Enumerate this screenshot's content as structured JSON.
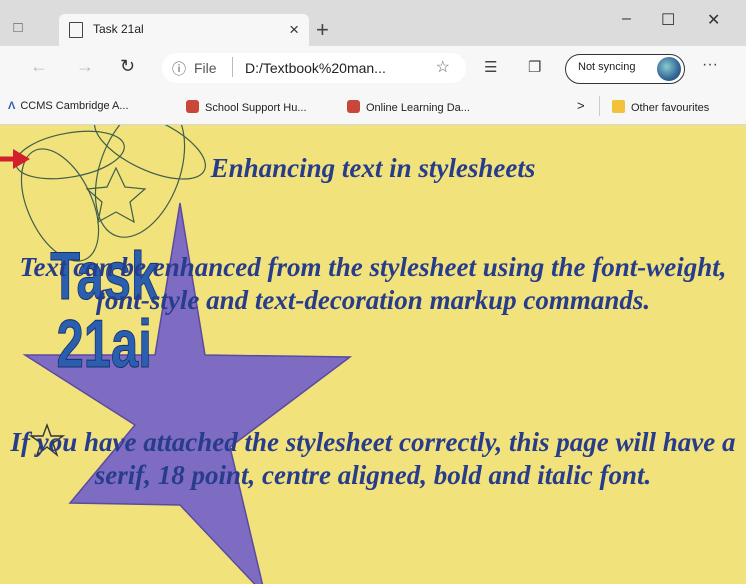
{
  "browser": {
    "tab_title": "Task 21al",
    "address_info": "ⓘ",
    "address_scheme": "File",
    "address_url": "D:/Textbook%20man...",
    "sync_label": "Not syncing",
    "more_label": "···"
  },
  "bookmarks": {
    "items": [
      {
        "label": "CCMS Cambridge A...",
        "color": "#2a5fb0"
      },
      {
        "label": "School Support Hu...",
        "color": "#c8463a"
      },
      {
        "label": "Online Learning Da...",
        "color": "#c8463a"
      }
    ],
    "chevron": ">",
    "other": "Other favourites"
  },
  "page": {
    "heading": "Enhancing text in stylesheets",
    "paragraph1": "Text can be enhanced from the stylesheet using the font-weight, font-style and text-decoration markup commands.",
    "paragraph2": "If you have attached the stylesheet correctly, this page will have a serif, 18 point, centre aligned, bold and italic font.",
    "badge_line1": "Task",
    "badge_line2": "21ai"
  },
  "colors": {
    "page_background": "#f1e27c",
    "text": "#283c8c",
    "star": "#7e6cc2",
    "arrow": "#d11f2b"
  }
}
